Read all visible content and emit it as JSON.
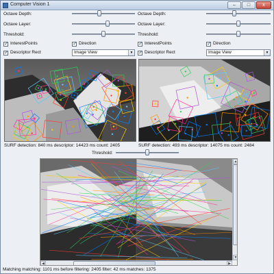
{
  "window": {
    "title": "Computer Vision 1",
    "minimize_label": "–",
    "maximize_label": "□",
    "close_label": "x"
  },
  "left_controls": {
    "octave_depth_label": "Octave Depth:",
    "octave_layer_label": "Octave Layer:",
    "threshold_label": "Threshold:",
    "octave_depth_value": 0.44,
    "octave_layer_value": 0.56,
    "threshold_value": 0.5,
    "interest_points": {
      "label": "InterestPoints",
      "checked": true
    },
    "descriptor_rect": {
      "label": "Descriptor Rect",
      "checked": true
    },
    "direction": {
      "label": "Direction",
      "checked": true
    },
    "view_select": "Image View"
  },
  "right_controls": {
    "octave_depth_label": "Octave Depth:",
    "octave_layer_label": "Octave Layer:",
    "threshold_label": "Threshold:",
    "octave_depth_value": 0.44,
    "octave_layer_value": 0.5,
    "threshold_value": 0.5,
    "interest_points": {
      "label": "InterestPoints",
      "checked": true
    },
    "descriptor_rect": {
      "label": "Descriptor Rect",
      "checked": true
    },
    "direction": {
      "label": "Direction",
      "checked": true
    },
    "view_select": "Image View"
  },
  "status_left": "SURF detection: 840 ms  descriptor: 14423 ms  count: 2405",
  "status_right": "SURF detection: 493 ms  descriptor: 14075 ms  count: 2484",
  "matching_threshold": {
    "label": "Threshold:",
    "value": 0.5
  },
  "matching_status": "Matching matching: 1101 ms  before filtering: 2405  filter: 42 ms  matches: 1375",
  "scroll": {
    "up_arrow": "▲",
    "down_arrow": "▼",
    "left_arrow": "◀",
    "right_arrow": "▶",
    "horizontal_position": 0.28,
    "vertical_position": 0.0
  }
}
